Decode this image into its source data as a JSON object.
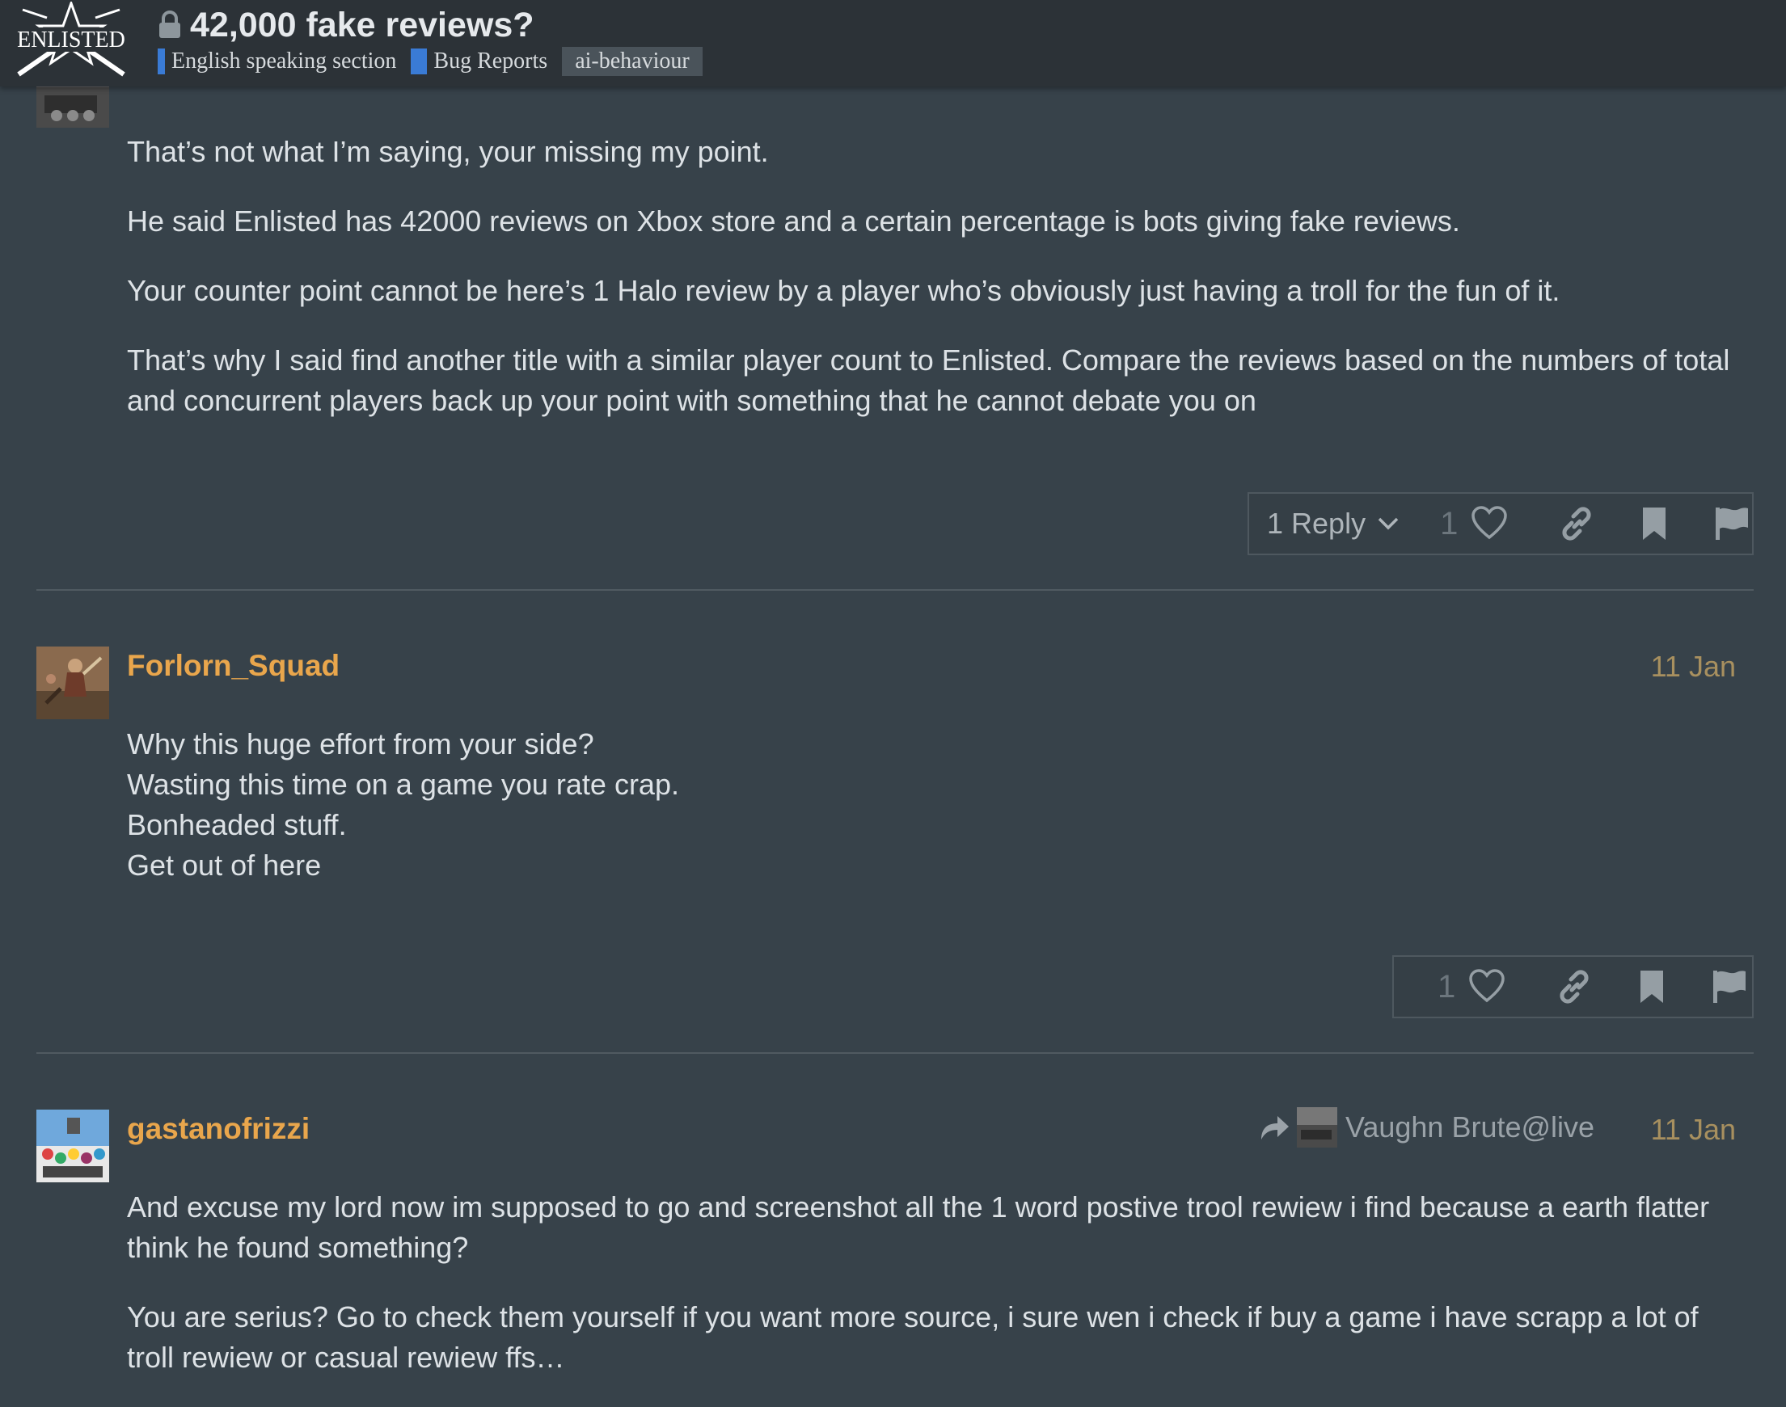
{
  "header": {
    "logo_text": "ENLISTED",
    "title": "42,000 fake reviews?",
    "categories": [
      {
        "label": "English speaking section",
        "color": "#3a7bd5"
      },
      {
        "label": "Bug Reports",
        "color": "#3a7bd5"
      }
    ],
    "tag": "ai-behaviour"
  },
  "posts": [
    {
      "paragraphs": [
        "That’s not what I’m saying, your missing my point.",
        "He said Enlisted has 42000 reviews on Xbox store and a certain percentage is bots giving fake reviews.",
        "Your counter point cannot be here’s 1 Halo review by a player who’s obviously just having a troll for the fun of it.",
        "That’s why I said find another title with a similar player count to Enlisted. Compare the reviews based on the numbers of total and concurrent players back up your point with something that he cannot debate you on"
      ],
      "actions": {
        "reply_label": "1 Reply",
        "like_count": "1"
      }
    },
    {
      "username": "Forlorn_Squad",
      "date": "11 Jan",
      "lines": [
        "Why this huge effort from your side?",
        "Wasting this time on a game you rate crap.",
        "Bonheaded stuff.",
        "Get out of here"
      ],
      "actions": {
        "like_count": "1"
      }
    },
    {
      "username": "gastanofrizzi",
      "date": "11 Jan",
      "reply_to": "Vaughn Brute@live",
      "paragraphs": [
        "And excuse my lord now im supposed to go and screenshot all the 1 word postive trool rewiew i find because a earth flatter think he found something?",
        "You are serius? Go to check them yourself if you want more source, i sure wen i check if buy a game i have scrapp a lot of troll rewiew or casual rewiew ffs…"
      ]
    }
  ],
  "colors": {
    "background": "#37424a",
    "header": "#2c3237",
    "username": "#e9a64c",
    "date": "#a8905f",
    "category": "#3a7bd5"
  },
  "icons": [
    "lock-icon",
    "heart-icon",
    "link-icon",
    "bookmark-icon",
    "flag-icon",
    "chevron-down-icon",
    "reply-arrow-icon"
  ]
}
